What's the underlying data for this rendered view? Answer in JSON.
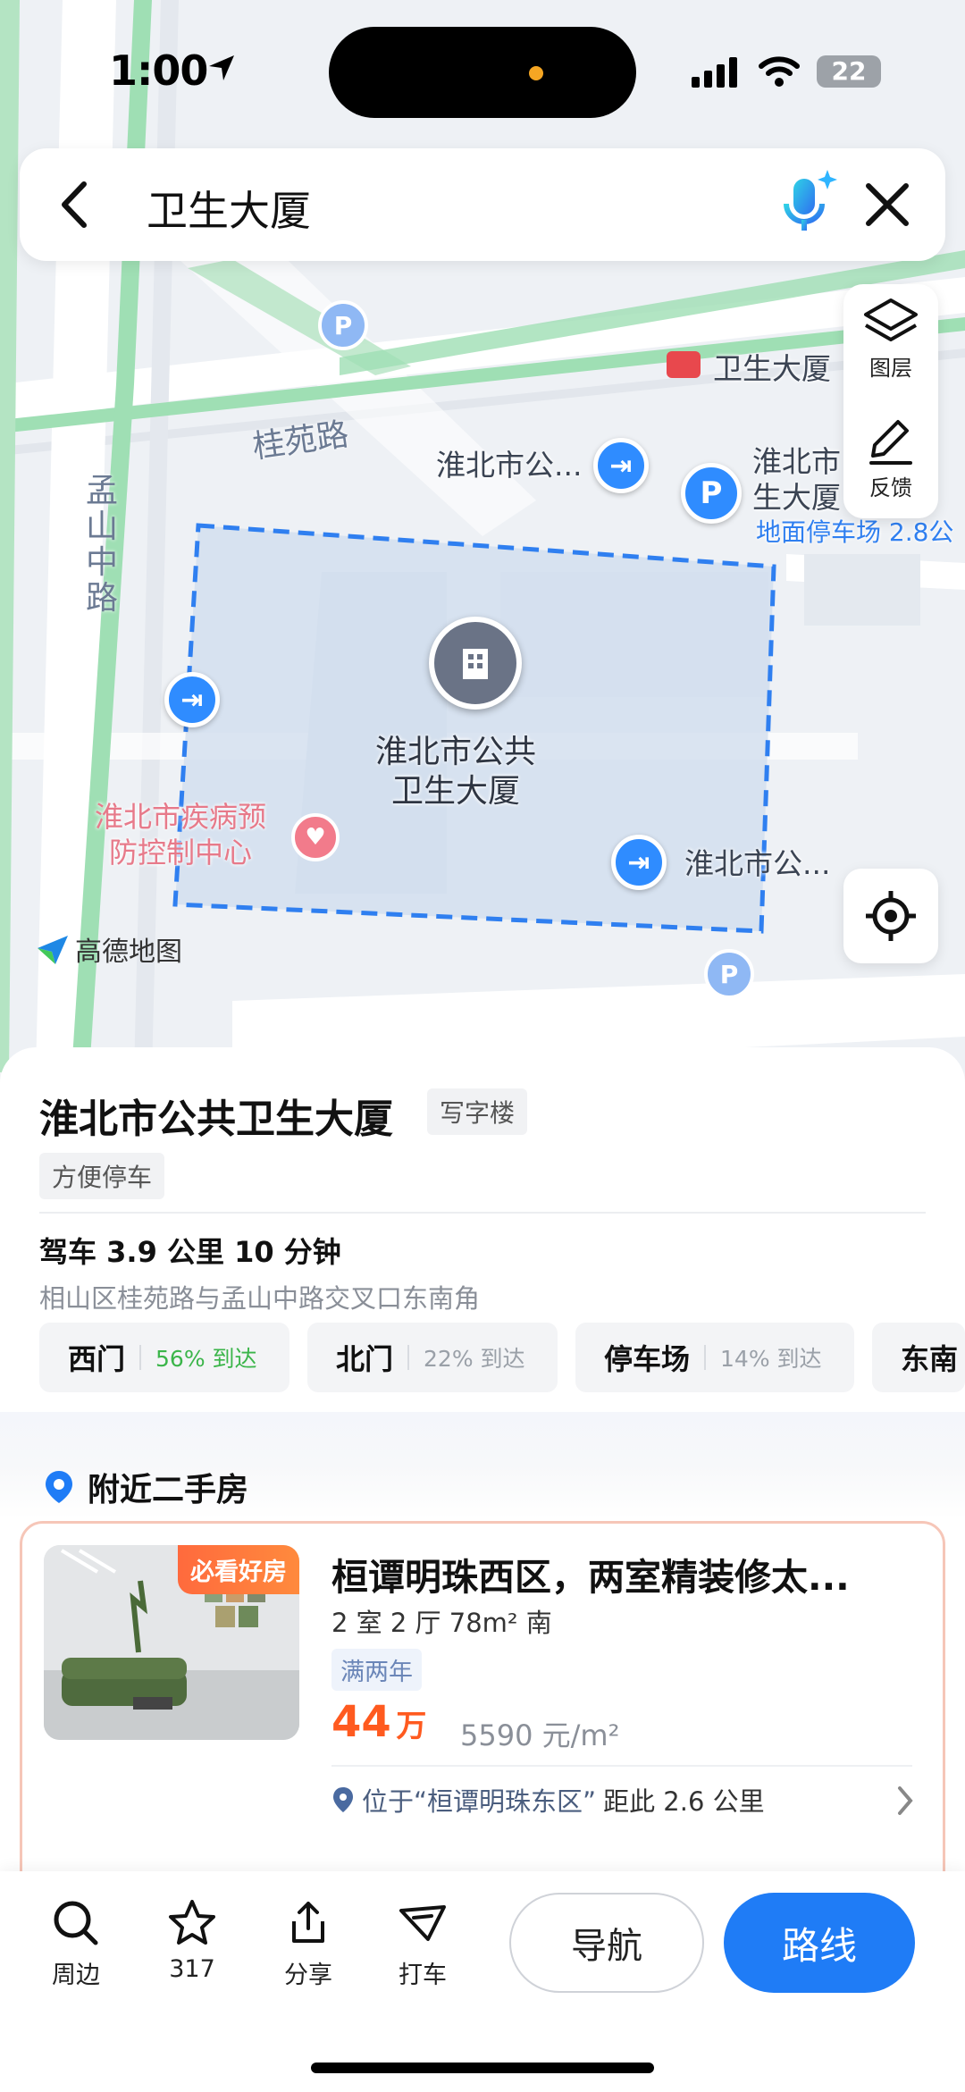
{
  "status_bar": {
    "time": "1:00",
    "battery": "22"
  },
  "search": {
    "query": "卫生大厦"
  },
  "map_tools": {
    "layers_label": "图层",
    "feedback_label": "反馈"
  },
  "map": {
    "poi_main": "淮北市公共\n卫生大厦",
    "poi_top_right": "卫生大厦",
    "poi_left_top": "淮北市公...",
    "poi_right_partial_line1": "淮北市",
    "poi_right_partial_line2": "生大厦",
    "parking_label": "地面停车场 2.8公",
    "poi_cdc": "淮北市疾病预\n防控制中心",
    "poi_lower_right": "淮北市公...",
    "road_guiyuan": "桂苑路",
    "road_mengshan": "孟山中路",
    "brand": "高德地图",
    "parking_glyph": "P"
  },
  "place": {
    "title": "淮北市公共卫生大厦",
    "category": "写字楼",
    "feature_tag": "方便停车",
    "drive_info": "驾车 3.9 公里 10 分钟",
    "address": "相山区桂苑路与孟山中路交叉口东南角",
    "gates": [
      {
        "name": "西门",
        "pct": "56% 到达",
        "color": "#3bb54a"
      },
      {
        "name": "北门",
        "pct": "22% 到达",
        "color": "#9aa0a8"
      },
      {
        "name": "停车场",
        "pct": "14% 到达",
        "color": "#9aa0a8"
      },
      {
        "name": "东南",
        "pct": "",
        "color": "#9aa0a8"
      }
    ]
  },
  "nearby": {
    "section_title": "附近二手房",
    "card": {
      "badge": "必看好房",
      "title": "桓谭明珠西区，两室精装修太...",
      "spec": "2 室 2 厅 78m² 南",
      "tag": "满两年",
      "price_num": "44",
      "price_unit": "万",
      "unit_price": "5590 元/m²",
      "location_prefix": "位于“桓谭明珠东区”",
      "location_distance": "距此 2.6 公里"
    }
  },
  "bottom_bar": {
    "nearby_label": "周边",
    "favorites_count": "317",
    "share_label": "分享",
    "taxi_label": "打车",
    "navigate_label": "导航",
    "route_label": "路线"
  },
  "colors": {
    "accent": "#1f7cf6",
    "price": "#ff5a1f",
    "map_route": "#9fdfb4",
    "highlight": "#2f7ff0"
  }
}
